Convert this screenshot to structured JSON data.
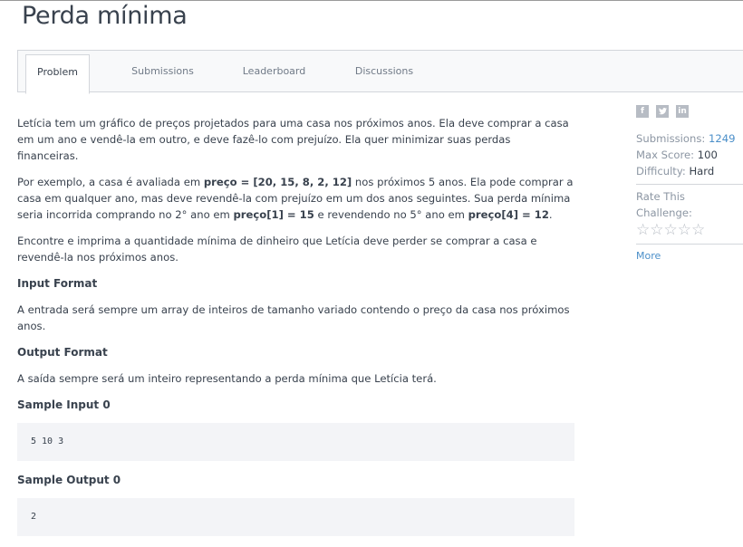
{
  "page": {
    "title": "Perda mínima"
  },
  "tabs": [
    {
      "label": "Problem",
      "active": true
    },
    {
      "label": "Submissions",
      "active": false
    },
    {
      "label": "Leaderboard",
      "active": false
    },
    {
      "label": "Discussions",
      "active": false
    }
  ],
  "problem": {
    "intro": "Letícia tem um gráfico de preços projetados para uma casa nos próximos anos. Ela deve comprar a casa em um ano e vendê-la em outro, e deve fazê-lo com prejuízo. Ela quer minimizar suas perdas financeiras.",
    "example": {
      "t1": "Por exemplo, a casa é avaliada em ",
      "b1": "preço = [20, 15, 8, 2, 12]",
      "t2": " nos próximos 5 anos. Ela pode comprar a casa em qualquer ano, mas deve revendê-la com prejuízo em um dos anos seguintes. Sua perda mínima seria incorrida comprando no 2° ano em ",
      "b2": "preço[1] = 15",
      "t3": " e revendendo no 5° ano em ",
      "b3": "preço[4] = 12",
      "t4": "."
    },
    "task": "Encontre e imprima a quantidade mínima de dinheiro que Letícia deve perder se comprar a casa e revendê-la nos próximos anos.",
    "input_format_title": "Input Format",
    "input_format": "A entrada será sempre um array de inteiros de tamanho variado contendo o preço da casa nos próximos anos.",
    "output_format_title": "Output Format",
    "output_format": "A saída sempre será um inteiro representando a perda mínima que Letícia terá.",
    "sample_input_title": "Sample Input 0",
    "sample_input": "5 10 3",
    "sample_output_title": "Sample Output 0",
    "sample_output": "2"
  },
  "sidebar": {
    "social": [
      "facebook-icon",
      "twitter-icon",
      "linkedin-icon"
    ],
    "submissions_label": "Submissions:",
    "submissions_value": "1249",
    "max_score_label": "Max Score:",
    "max_score_value": "100",
    "difficulty_label": "Difficulty:",
    "difficulty_value": "Hard",
    "rate_label": "Rate This Challenge:",
    "stars": "☆☆☆☆☆",
    "more_label": "More"
  },
  "colors": {
    "text": "#39424e",
    "muted": "#8c96a3",
    "link": "#4b8fc9",
    "code_bg": "#f3f4f7"
  }
}
